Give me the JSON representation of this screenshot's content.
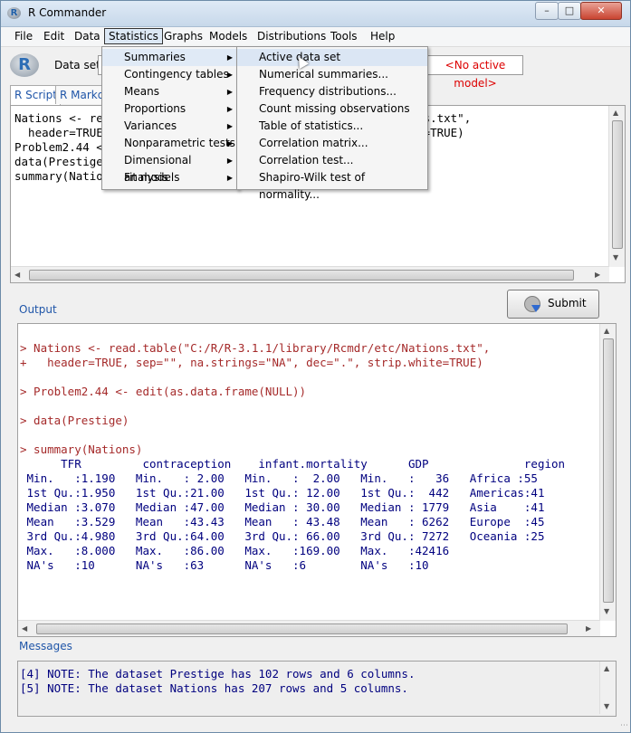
{
  "window": {
    "title": "R Commander"
  },
  "menubar": [
    "File",
    "Edit",
    "Data",
    "Statistics",
    "Graphs",
    "Models",
    "Distributions",
    "Tools",
    "Help"
  ],
  "toolbar": {
    "dataset_label": "Data set:",
    "model": "<No active model>"
  },
  "tabs": [
    "R Script",
    "R Markdown"
  ],
  "script_lines": [
    "Nations <- read.table(\"C:/R/R-3.1.1/library/Rcmdr/etc/Nations.txt\",",
    "  header=TRUE, sep=\"\", na.strings=\"NA\", dec=\".\", strip.white=TRUE)",
    "Problem2.44 <- edit(as.data.frame(NULL))",
    "data(Prestige)",
    "summary(Nations)"
  ],
  "output_label": "Output",
  "submit_label": "Submit",
  "output_lines": [
    {
      "t": "cmd",
      "s": "> Nations <- read.table(\"C:/R/R-3.1.1/library/Rcmdr/etc/Nations.txt\","
    },
    {
      "t": "cmd",
      "s": "+   header=TRUE, sep=\"\", na.strings=\"NA\", dec=\".\", strip.white=TRUE)"
    },
    {
      "t": "res",
      "s": ""
    },
    {
      "t": "cmd",
      "s": "> Problem2.44 <- edit(as.data.frame(NULL))"
    },
    {
      "t": "res",
      "s": ""
    },
    {
      "t": "cmd",
      "s": "> data(Prestige)"
    },
    {
      "t": "res",
      "s": ""
    },
    {
      "t": "cmd",
      "s": "> summary(Nations)"
    },
    {
      "t": "res",
      "s": "      TFR         contraception    infant.mortality      GDP              region"
    },
    {
      "t": "res",
      "s": " Min.   :1.190   Min.   : 2.00   Min.   :  2.00   Min.   :   36   Africa :55"
    },
    {
      "t": "res",
      "s": " 1st Qu.:1.950   1st Qu.:21.00   1st Qu.: 12.00   1st Qu.:  442   Americas:41"
    },
    {
      "t": "res",
      "s": " Median :3.070   Median :47.00   Median : 30.00   Median : 1779   Asia    :41"
    },
    {
      "t": "res",
      "s": " Mean   :3.529   Mean   :43.43   Mean   : 43.48   Mean   : 6262   Europe  :45"
    },
    {
      "t": "res",
      "s": " 3rd Qu.:4.980   3rd Qu.:64.00   3rd Qu.: 66.00   3rd Qu.: 7272   Oceania :25"
    },
    {
      "t": "res",
      "s": " Max.   :8.000   Max.   :86.00   Max.   :169.00   Max.   :42416"
    },
    {
      "t": "res",
      "s": " NA's   :10      NA's   :63      NA's   :6        NA's   :10"
    }
  ],
  "messages_label": "Messages",
  "messages": [
    "[4] NOTE: The dataset Prestige has 102 rows and 6 columns.",
    "[5] NOTE: The dataset Nations has 207 rows and 5 columns."
  ],
  "statistics_menu": [
    {
      "label": "Summaries",
      "submenu": true
    },
    {
      "label": "Contingency tables",
      "submenu": true
    },
    {
      "label": "Means",
      "submenu": true
    },
    {
      "label": "Proportions",
      "submenu": true
    },
    {
      "label": "Variances",
      "submenu": true
    },
    {
      "label": "Nonparametric tests",
      "submenu": true
    },
    {
      "label": "Dimensional analysis",
      "submenu": true
    },
    {
      "label": "Fit models",
      "submenu": true
    }
  ],
  "summaries_submenu": [
    "Active data set",
    "Numerical summaries...",
    "Frequency distributions...",
    "Count missing observations",
    "Table of statistics...",
    "Correlation matrix...",
    "Correlation test...",
    "Shapiro-Wilk test of normality..."
  ]
}
